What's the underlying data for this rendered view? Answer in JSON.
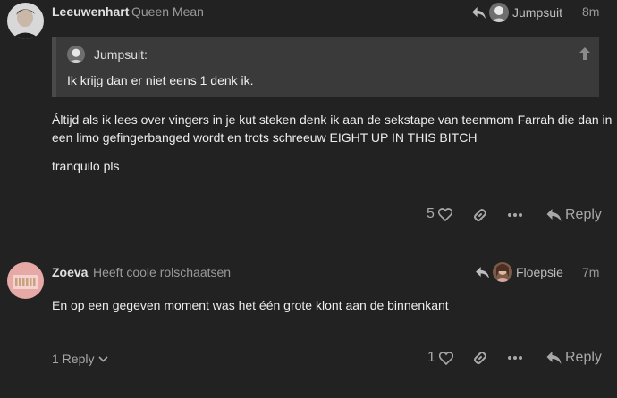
{
  "post1": {
    "username": "Leeuwenhart",
    "user_title": "Queen Mean",
    "reply_to_user": "Jumpsuit",
    "time": "8m",
    "quote": {
      "author": "Jumpsuit:",
      "text": "Ik krijg dan er niet eens 1 denk ik."
    },
    "body_line1": "Áltijd als ik lees over vingers in je kut steken denk ik aan de sekstape van teenmom Farrah die dan in",
    "body_line2": "een limo gefingerbanged wordt en trots schreeuw EIGHT UP IN THIS BITCH",
    "body_line3": "tranquilo pls",
    "like_count": "5",
    "reply_label": "Reply"
  },
  "post2": {
    "username": "Zoeva",
    "user_title": "Heeft coole rolschaatsen",
    "reply_to_user": "Floepsie",
    "time": "7m",
    "body": "En op een gegeven moment was het één grote klont aan de binnenkant",
    "replies_label": "1 Reply",
    "like_count": "1",
    "reply_label": "Reply"
  },
  "colors": {
    "background": "#222222",
    "quote_bg": "#3a3a3a",
    "muted": "#9a9a9a"
  }
}
